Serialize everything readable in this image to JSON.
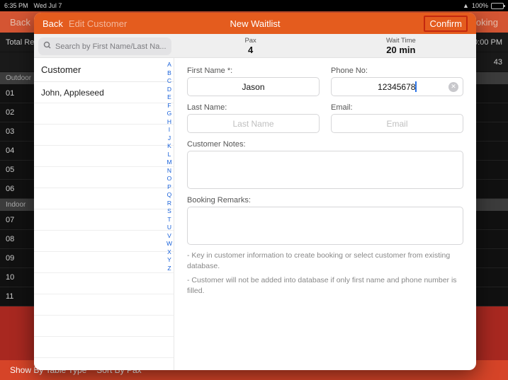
{
  "statusbar": {
    "time": "6:35 PM",
    "date": "Wed Jul 7",
    "battery": "100%"
  },
  "bg": {
    "back": "Back",
    "booking": "oking",
    "total": "Total Re",
    "righttime": "0:00 PM",
    "count": "43",
    "sections": {
      "outdoor": "Outdoor",
      "indoor": "Indoor"
    },
    "rows_out": [
      "01",
      "02",
      "03",
      "04",
      "05",
      "06"
    ],
    "rows_in": [
      "07",
      "08",
      "09",
      "10",
      "11"
    ],
    "footer": {
      "a": "Show By Table Type",
      "b": "Sort By Pax"
    }
  },
  "header": {
    "back": "Back",
    "edit": "Edit Customer",
    "title": "New Waitlist",
    "confirm": "Confirm"
  },
  "bar": {
    "search_placeholder": "Search by First Name/Last Na...",
    "pax_label": "Pax",
    "pax_value": "4",
    "wait_label": "Wait Time",
    "wait_value": "20 min"
  },
  "list": {
    "section": "Customer",
    "items": [
      "John, Appleseed"
    ],
    "index": [
      "A",
      "B",
      "C",
      "D",
      "E",
      "F",
      "G",
      "H",
      "I",
      "J",
      "K",
      "L",
      "M",
      "N",
      "O",
      "P",
      "Q",
      "R",
      "S",
      "T",
      "U",
      "V",
      "W",
      "X",
      "Y",
      "Z"
    ]
  },
  "form": {
    "first_name_label": "First Name *:",
    "first_name_value": "Jason",
    "phone_label": "Phone No:",
    "phone_value": "12345678",
    "last_name_label": "Last Name:",
    "last_name_placeholder": "Last Name",
    "email_label": "Email:",
    "email_placeholder": "Email",
    "notes_label": "Customer Notes:",
    "remarks_label": "Booking Remarks:",
    "info1": "- Key in customer information to create booking or select customer from existing database.",
    "info2": "- Customer will not be added into database if only first name and phone number is filled."
  }
}
